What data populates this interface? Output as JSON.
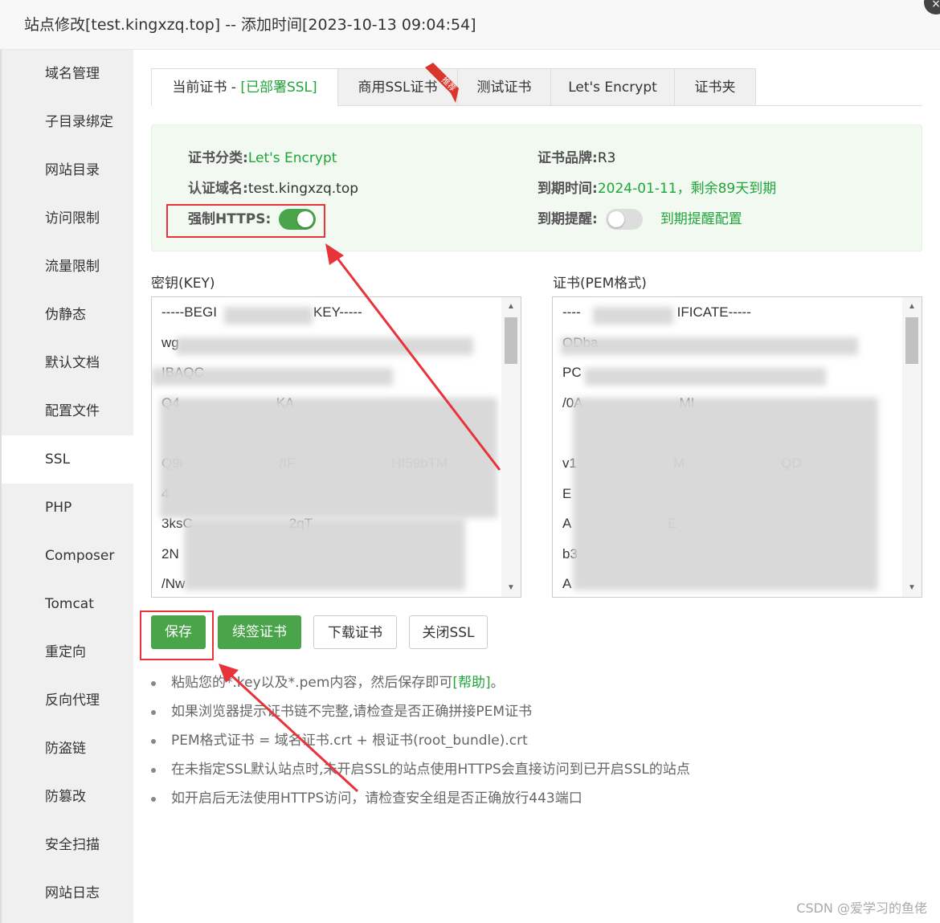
{
  "title": "站点修改[test.kingxzq.top] -- 添加时间[2023-10-13 09:04:54]",
  "close_icon": "×",
  "sidebar": {
    "items": [
      "域名管理",
      "子目录绑定",
      "网站目录",
      "访问限制",
      "流量限制",
      "伪静态",
      "默认文档",
      "配置文件",
      "SSL",
      "PHP",
      "Composer",
      "Tomcat",
      "重定向",
      "反向代理",
      "防盗链",
      "防篡改",
      "安全扫描",
      "网站日志"
    ],
    "active": "SSL"
  },
  "tabs": {
    "current_prefix": "当前证书 - ",
    "current_status": "[已部署SSL]",
    "items": [
      "商用SSL证书",
      "测试证书",
      "Let's Encrypt",
      "证书夹"
    ],
    "ribbon": "推荐"
  },
  "info": {
    "cert_type_label": "证书分类:",
    "cert_type": "Let's Encrypt",
    "domain_label": "认证域名:",
    "domain": "test.kingxzq.top",
    "force_https_label": "强制HTTPS:",
    "force_https": true,
    "brand_label": "证书品牌:",
    "brand": "R3",
    "expiry_label": "到期时间:",
    "expiry": "2024-01-11，剩余89天到期",
    "reminder_label": "到期提醒:",
    "reminder": false,
    "reminder_config": "到期提醒配置"
  },
  "key": {
    "label": "密钥(KEY)",
    "lines": [
      "-----BEGI",
      "KEY-----",
      "wg",
      "IBAQC",
      "Q4",
      "KA",
      "Q9i",
      "/IF",
      "Hf59bTM",
      "4",
      "3ksC",
      "2qT",
      "2N",
      "/Nw"
    ]
  },
  "pem": {
    "label": "证书(PEM格式)",
    "lines": [
      "----",
      "IFICATE-----",
      "ODba",
      "PC",
      "/0A",
      "MI",
      "v1",
      "M",
      "QD",
      "E",
      "A",
      "E",
      "b3",
      "A"
    ]
  },
  "buttons": {
    "save": "保存",
    "renew": "续签证书",
    "download": "下载证书",
    "close_ssl": "关闭SSL"
  },
  "tips": [
    "粘贴您的*.key以及*.pem内容，然后保存即可",
    "[帮助]",
    "。",
    "如果浏览器提示证书链不完整,请检查是否正确拼接PEM证书",
    "PEM格式证书 = 域名证书.crt + 根证书(root_bundle).crt",
    "在未指定SSL默认站点时,未开启SSL的站点使用HTTPS会直接访问到已开启SSL的站点",
    "如开启后无法使用HTTPS访问，请检查安全组是否正确放行443端口"
  ],
  "watermark": "CSDN @爱学习的鱼佬",
  "colors": {
    "green": "#20a53a",
    "button_green": "#4aa44a",
    "annotation_red": "#e8333b"
  }
}
